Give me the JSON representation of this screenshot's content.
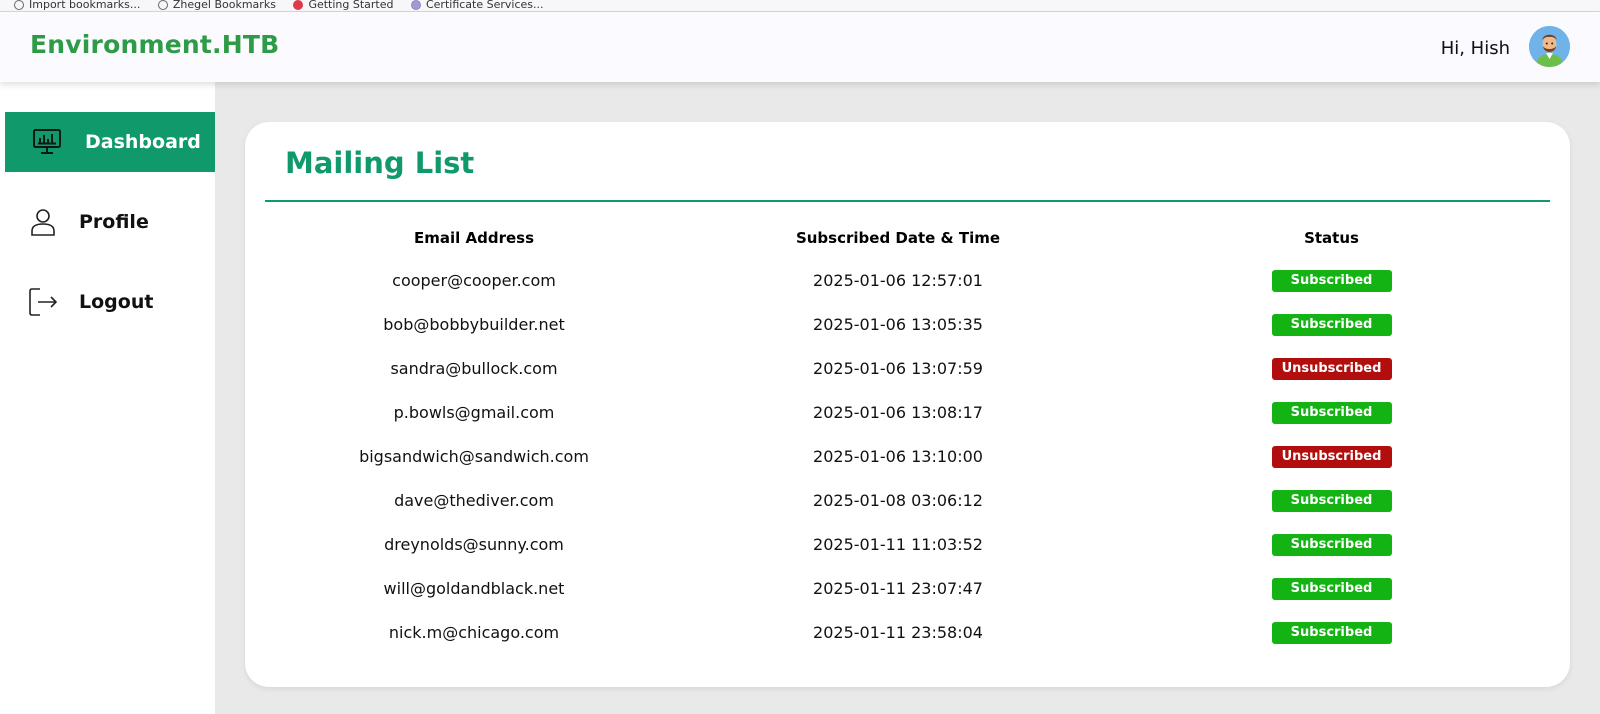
{
  "bookmarks": [
    {
      "label": "Import bookmarks...",
      "icon": "page-icon"
    },
    {
      "label": "Zhegel Bookmarks",
      "icon": "folder-icon"
    },
    {
      "label": "Getting Started",
      "icon": "firefox-icon"
    },
    {
      "label": "Certificate Services...",
      "icon": "shield-icon"
    }
  ],
  "header": {
    "brand": "Environment.HTB",
    "greeting": "Hi, Hish",
    "avatar_icon": "user-avatar"
  },
  "sidebar": {
    "items": [
      {
        "label": "Dashboard",
        "icon": "monitor-chart-icon",
        "active": true
      },
      {
        "label": "Profile",
        "icon": "user-icon",
        "active": false
      },
      {
        "label": "Logout",
        "icon": "logout-icon",
        "active": false
      }
    ]
  },
  "main": {
    "title": "Mailing List",
    "columns": [
      "Email Address",
      "Subscribed Date & Time",
      "Status"
    ],
    "rows": [
      {
        "email": "cooper@cooper.com",
        "date": "2025-01-06 12:57:01",
        "status": "Subscribed"
      },
      {
        "email": "bob@bobbybuilder.net",
        "date": "2025-01-06 13:05:35",
        "status": "Subscribed"
      },
      {
        "email": "sandra@bullock.com",
        "date": "2025-01-06 13:07:59",
        "status": "Unsubscribed"
      },
      {
        "email": "p.bowls@gmail.com",
        "date": "2025-01-06 13:08:17",
        "status": "Subscribed"
      },
      {
        "email": "bigsandwich@sandwich.com",
        "date": "2025-01-06 13:10:00",
        "status": "Unsubscribed"
      },
      {
        "email": "dave@thediver.com",
        "date": "2025-01-08 03:06:12",
        "status": "Subscribed"
      },
      {
        "email": "dreynolds@sunny.com",
        "date": "2025-01-11 11:03:52",
        "status": "Subscribed"
      },
      {
        "email": "will@goldandblack.net",
        "date": "2025-01-11 23:07:47",
        "status": "Subscribed"
      },
      {
        "email": "nick.m@chicago.com",
        "date": "2025-01-11 23:58:04",
        "status": "Subscribed"
      }
    ]
  },
  "colors": {
    "brand": "#2e9b47",
    "accent": "#10996a",
    "subscribed": "#12b312",
    "unsubscribed": "#b30e0e"
  }
}
